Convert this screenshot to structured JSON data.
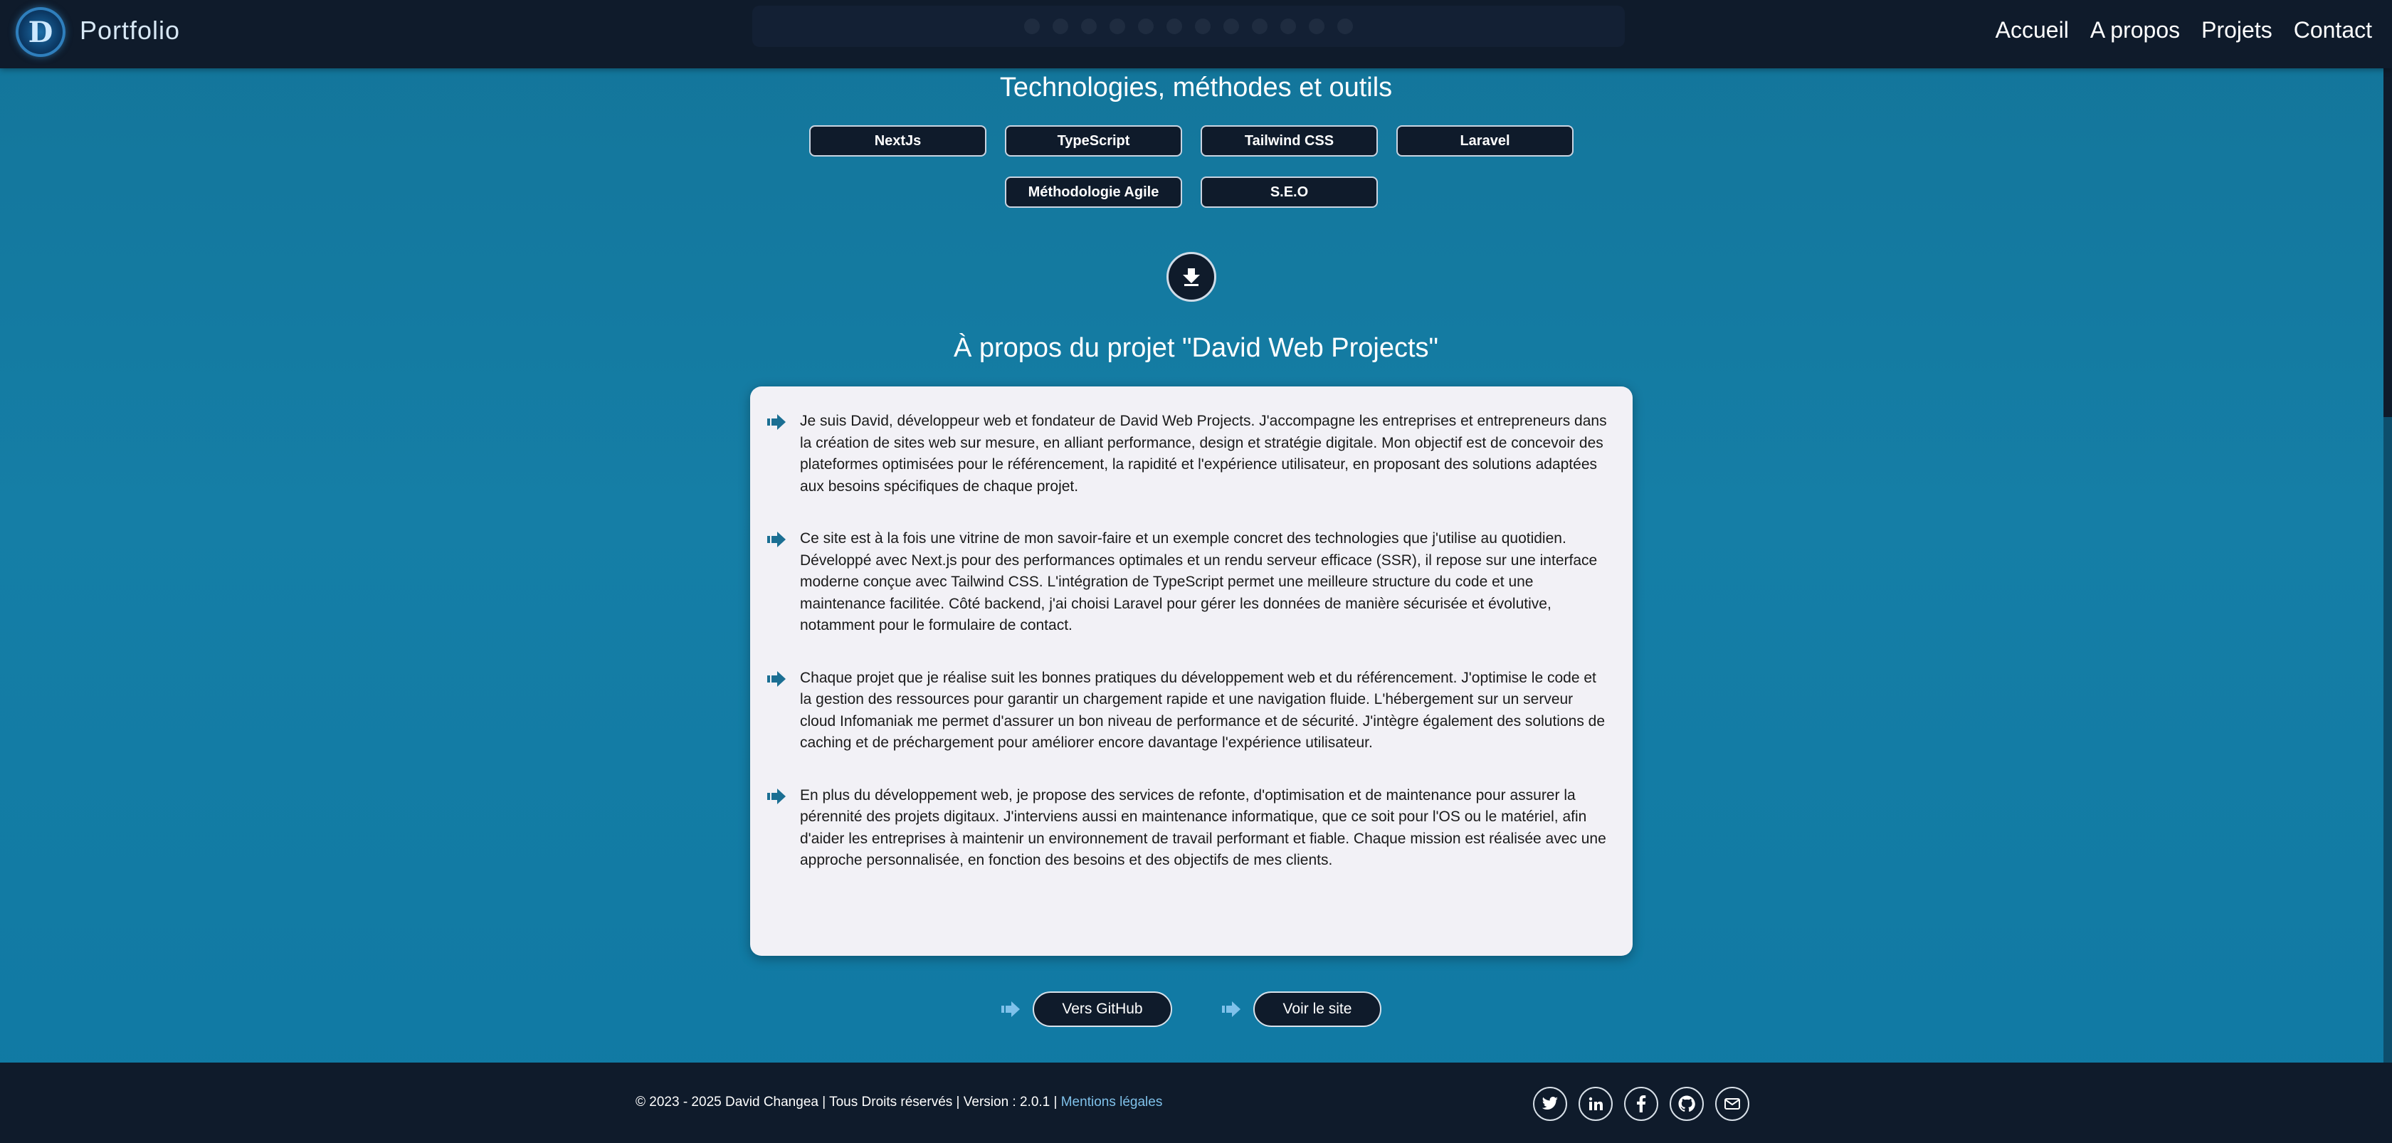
{
  "header": {
    "brand": "Portfolio",
    "logo_letter": "D",
    "nav": [
      "Accueil",
      "A propos",
      "Projets",
      "Contact"
    ]
  },
  "tech": {
    "title": "Technologies, méthodes et outils",
    "chips": [
      "NextJs",
      "TypeScript",
      "Tailwind CSS",
      "Laravel",
      "Méthodologie Agile",
      "S.E.O"
    ]
  },
  "about": {
    "title": "À propos du projet \"David Web Projects\"",
    "paragraphs": [
      "Je suis David, développeur web et fondateur de David Web Projects. J'accompagne les entreprises et entrepreneurs dans la création de sites web sur mesure, en alliant performance, design et stratégie digitale. Mon objectif est de concevoir des plateformes optimisées pour le référencement, la rapidité et l'expérience utilisateur, en proposant des solutions adaptées aux besoins spécifiques de chaque projet.",
      "Ce site est à la fois une vitrine de mon savoir-faire et un exemple concret des technologies que j'utilise au quotidien. Développé avec Next.js pour des performances optimales et un rendu serveur efficace (SSR), il repose sur une interface moderne conçue avec Tailwind CSS. L'intégration de TypeScript permet une meilleure structure du code et une maintenance facilitée. Côté backend, j'ai choisi Laravel pour gérer les données de manière sécurisée et évolutive, notamment pour le formulaire de contact.",
      "Chaque projet que je réalise suit les bonnes pratiques du développement web et du référencement. J'optimise le code et la gestion des ressources pour garantir un chargement rapide et une navigation fluide. L'hébergement sur un serveur cloud Infomaniak me permet d'assurer un bon niveau de performance et de sécurité. J'intègre également des solutions de caching et de préchargement pour améliorer encore davantage l'expérience utilisateur.",
      "En plus du développement web, je propose des services de refonte, d'optimisation et de maintenance pour assurer la pérennité des projets digitaux. J'interviens aussi en maintenance informatique, que ce soit pour l'OS ou le matériel, afin d'aider les entreprises à maintenir un environnement de travail performant et fiable. Chaque mission est réalisée avec une approche personnalisée, en fonction des besoins et des objectifs de mes clients."
    ]
  },
  "links": {
    "github": "Vers GitHub",
    "site": "Voir le site"
  },
  "footer": {
    "copyright": "© 2023 - 2025 David Changea | Tous Droits réservés | Version : 2.0.1 |",
    "legal": "Mentions légales",
    "socials": [
      "twitter-icon",
      "linkedin-icon",
      "facebook-icon",
      "github-icon",
      "mail-icon"
    ]
  },
  "colors": {
    "background": "#1479a2",
    "dark": "#0f1b2b",
    "card": "#f2f1f6",
    "accent_arrow": "#1b6f93",
    "legal_link": "#7fc1ea"
  }
}
